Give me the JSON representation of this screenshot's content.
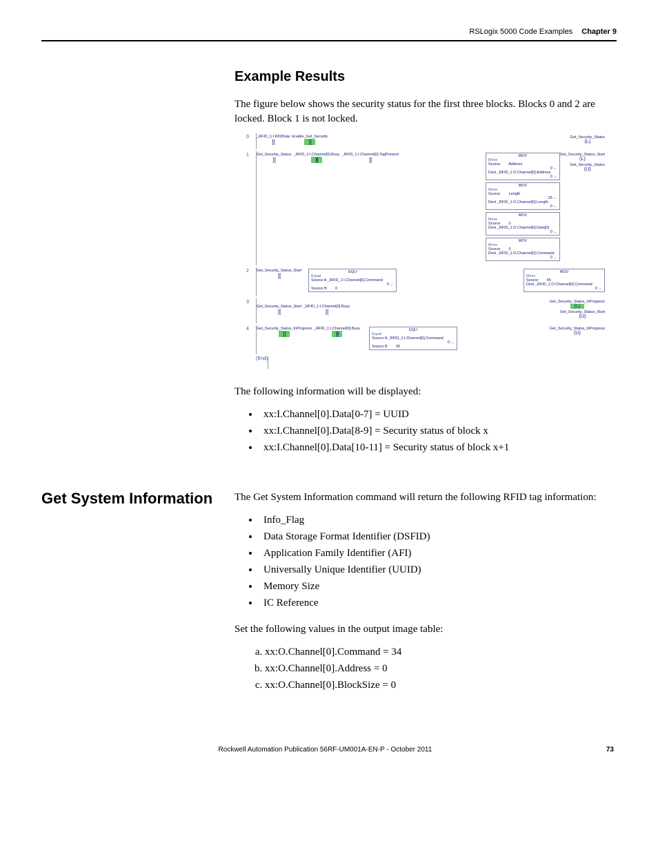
{
  "header": {
    "section": "RSLogix 5000 Code Examples",
    "chapter": "Chapter 9"
  },
  "example_results": {
    "heading": "Example Results",
    "intro": "The figure below shows the security status for the first three blocks. Blocks 0 and 2 are locked. Block 1 is not locked.",
    "after_figure": "The following information will be displayed:",
    "bullets": [
      "xx:I.Channel[0].Data[0-7] = UUID",
      "xx:I.Channel[0].Data[8-9] = Security status of block x",
      "xx:I.Channel[0].Data[10-11] = Security status of block x+1"
    ]
  },
  "figure": {
    "rungs": [
      "0",
      "1",
      "2",
      "3",
      "4"
    ],
    "end": "(End)",
    "tags": {
      "r0_c1": "_RFID_1:I.R00Data",
      "r0_c2": "Enable_Get_Security",
      "r0_coil": "Get_Security_Status",
      "r1_c1": "Get_Security_Status",
      "r1_c2": "_RFID_1:I.Channel[0].Busy",
      "r1_c3": "_RFID_1:I.Channel[0].TagPresent",
      "r1_coil1": "Get_Security_Status_Start",
      "r1_coil2": "Get_Security_Status",
      "mov_title": "MOV",
      "mov1_a": "Move",
      "mov1_b": "Source",
      "mov1_c": "Address",
      "mov1_d": "0 ←",
      "mov1_e": "Dest   _RFID_1:O.Channel[0].Address",
      "mov1_f": "0 ←",
      "mov2_a": "Move",
      "mov2_b": "Source",
      "mov2_c": "Length",
      "mov2_d": "25 ←",
      "mov2_e": "Dest   _RFID_1:O.Channel[0].Length",
      "mov2_f": "0 ←",
      "mov3_a": "Move",
      "mov3_b": "Source",
      "mov3_c": "0",
      "mov3_e": "Dest   _RFID_1:O.Channel[0].Data[0]",
      "mov3_f": "0 ←",
      "mov4_a": "Move",
      "mov4_b": "Source",
      "mov4_c": "0",
      "mov4_e": "Dest   _RFID_1:O.Channel[0].Command",
      "mov4_f": "0 ←",
      "r2_c1": "Get_Security_Status_Start",
      "r2_eq_title": "EQU",
      "r2_eq_a": "Equal",
      "r2_eq_b": "Source A   _RFID_1:I.Channel[0].Command",
      "r2_eq_c": "0 ←",
      "r2_eq_d": "Source B",
      "r2_eq_e": "0",
      "r2_mov_title": "MOV",
      "r2_mov_a": "Move",
      "r2_mov_b": "Source",
      "r2_mov_c": "45",
      "r2_mov_d": "Dest   _RFID_1:O.Channel[0].Command",
      "r2_mov_e": "0 ←",
      "r3_c1": "Get_Security_Status_Start",
      "r3_c2": "_RFID_1:I.Channel[0].Busy",
      "r3_coil1": "Get_Security_Status_InProgress",
      "r3_coil2": "Get_Security_Status_Start",
      "r4_c1": "Get_Security_Status_InProgress",
      "r4_c2": "_RFID_1:I.Channel[0].Busy",
      "r4_eq_title": "EQU",
      "r4_eq_a": "Equal",
      "r4_eq_b": "Source A   _RFID_1:I.Channel[0].Command",
      "r4_eq_c": "0 ←",
      "r4_eq_d": "Source B",
      "r4_eq_e": "45",
      "r4_coil": "Get_Security_Status_InProgress"
    }
  },
  "get_sys_info": {
    "heading": "Get System Information",
    "intro": "The Get System Information command will return the following RFID tag information:",
    "bullets": [
      "Info_Flag",
      "Data Storage Format Identifier (DSFID)",
      "Application Family Identifier (AFI)",
      "Universally Unique Identifier (UUID)",
      "Memory Size",
      "IC Reference"
    ],
    "set_values": "Set the following values in the output image table:",
    "steps": [
      "xx:O.Channel[0].Command = 34",
      "xx:O.Channel[0].Address = 0",
      "xx:O.Channel[0].BlockSize = 0"
    ]
  },
  "footer": {
    "publication": "Rockwell Automation Publication 56RF-UM001A-EN-P - October 2011",
    "page": "73"
  }
}
